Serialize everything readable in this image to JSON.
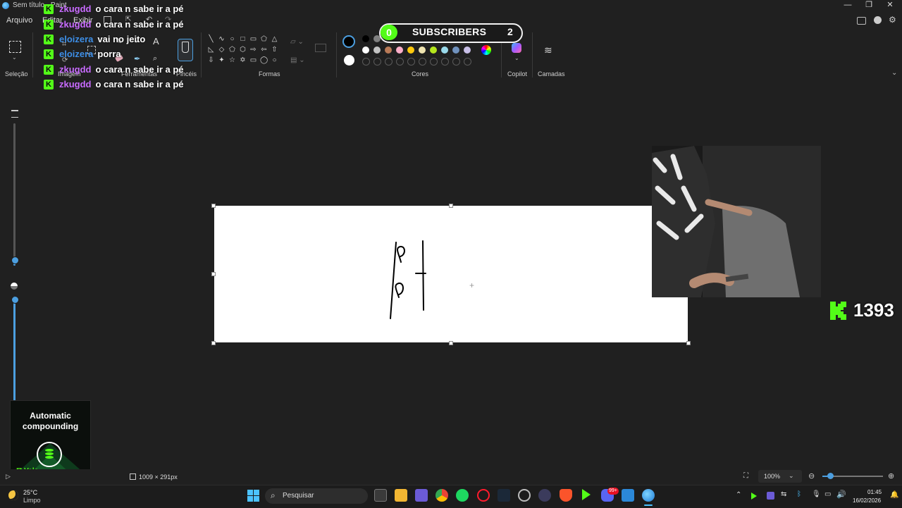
{
  "window": {
    "title": "Sem título - Paint",
    "controls": [
      "—",
      "❐",
      "✕"
    ]
  },
  "menu": {
    "file": "Arquivo",
    "edit": "Editar",
    "view": "Exibir"
  },
  "ribbon": {
    "groups": {
      "selection": "Seleção",
      "image": "Imagem",
      "tools": "Ferramentas",
      "brushes": "Pincéis",
      "shapes": "Formas",
      "colors": "Cores",
      "copilot": "Copilot",
      "layers": "Camadas"
    },
    "primary_color": "#000000",
    "secondary_color": "#ffffff",
    "palette_row1": [
      "#000000",
      "#808080",
      "#8b1a1a",
      "#e8242b",
      "#f3782a",
      "#f6d21c",
      "#27a243",
      "#29a8e0",
      "#3e48cc",
      "#a34ac2"
    ],
    "palette_row2": [
      "#ffffff",
      "#c3c3c3",
      "#b97a57",
      "#fcaec9",
      "#ffc90e",
      "#efe4b0",
      "#b5e61d",
      "#99d9ea",
      "#7092be",
      "#c8bfe7"
    ]
  },
  "chat": [
    {
      "user": "zkugdd",
      "color": "#c86bff",
      "message": "o cara n sabe ir a pé"
    },
    {
      "user": "zkugdd",
      "color": "#c86bff",
      "message": "o cara n sabe ir a pé"
    },
    {
      "user": "eloizera",
      "color": "#3d8ee6",
      "message": "vai no jeito"
    },
    {
      "user": "eloizera",
      "color": "#3d8ee6",
      "message": "porra"
    },
    {
      "user": "zkugdd",
      "color": "#c86bff",
      "message": "o cara n sabe ir a pé"
    },
    {
      "user": "zkugdd",
      "color": "#c86bff",
      "message": "o cara n sabe ir a pé"
    }
  ],
  "subscribers": {
    "left_count": "0",
    "label": "SUBSCRIBERS",
    "right_count": "2"
  },
  "viewers": {
    "count": "1393"
  },
  "ad": {
    "line1": "Automatic",
    "line2": "compounding",
    "brand": "Valo"
  },
  "statusbar": {
    "canvas_size": "1009 × 291px",
    "zoom": "100%"
  },
  "taskbar": {
    "weather_temp": "25°C",
    "weather_desc": "Limpo",
    "search_placeholder": "Pesquisar",
    "time": "01:45",
    "date": "16/02/2026",
    "discord_badge": "99+"
  }
}
